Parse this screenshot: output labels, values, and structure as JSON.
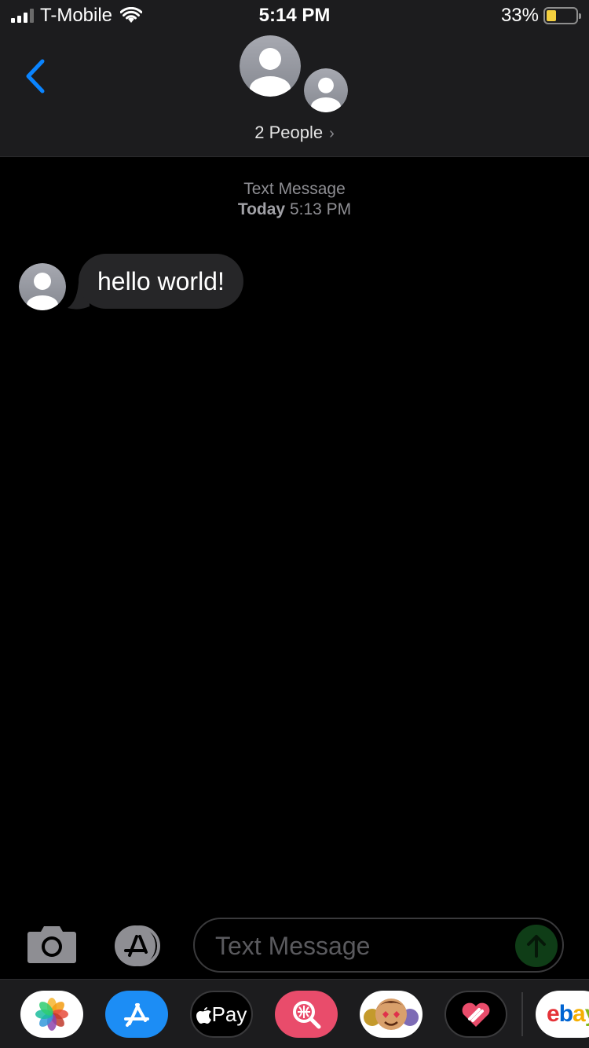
{
  "status_bar": {
    "carrier": "T-Mobile",
    "time": "5:14 PM",
    "battery_percent": "33%",
    "battery_level": 0.33
  },
  "header": {
    "recipients_label": "2 People",
    "chevron": "›"
  },
  "thread": {
    "service_label": "Text Message",
    "date_label": "Today",
    "time_label": "5:13 PM"
  },
  "messages": [
    {
      "direction": "incoming",
      "text": "hello world!"
    }
  ],
  "compose": {
    "placeholder": "Text Message"
  },
  "app_drawer": {
    "apple_pay_label": "Pay",
    "ebay_label": "ebay",
    "apps": [
      "photos-icon",
      "app-store-icon",
      "apple-pay-icon",
      "image-search-icon",
      "memoji-icon",
      "heart-icon",
      "ebay-icon"
    ]
  },
  "colors": {
    "accent_blue": "#0a84ff",
    "bubble_incoming": "#262628",
    "send_green": "#0f3d17",
    "battery_yellow": "#f4d03f"
  }
}
